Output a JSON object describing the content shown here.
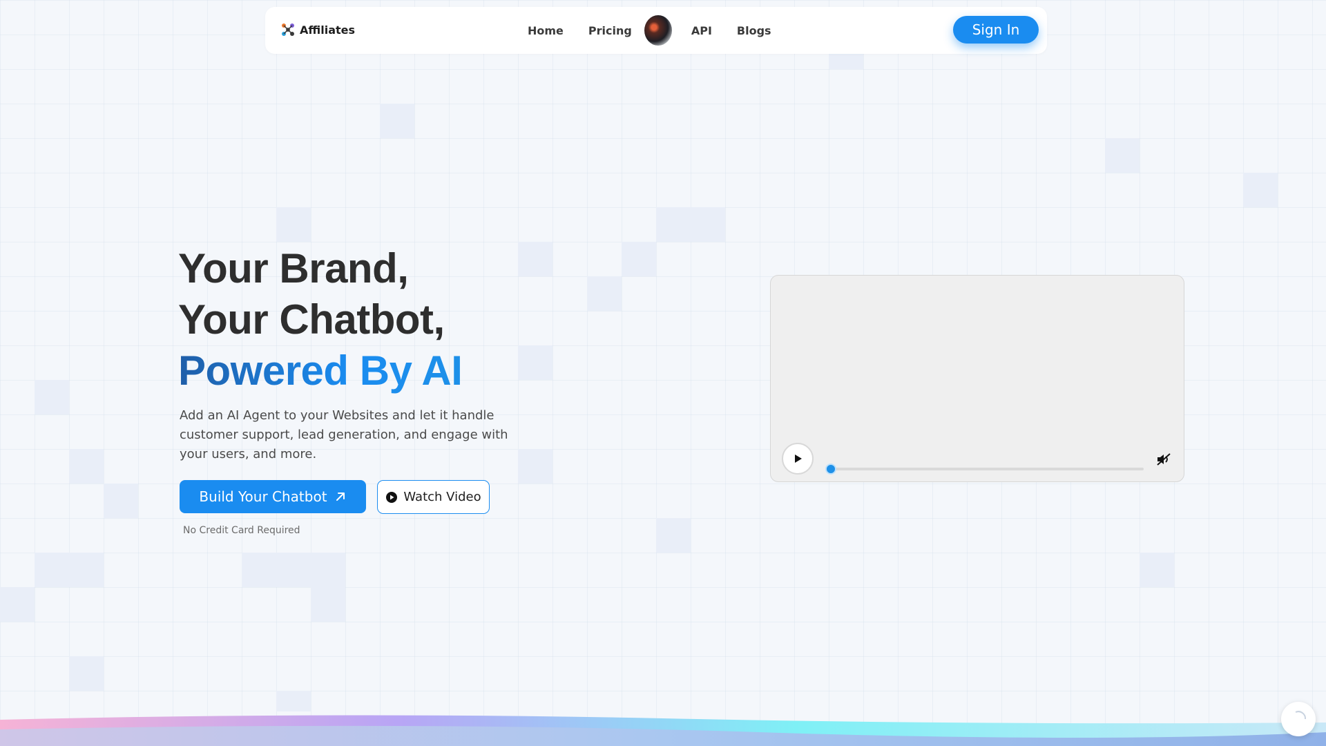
{
  "nav": {
    "brand": "Affiliates",
    "links": [
      "Home",
      "Pricing",
      "API",
      "Blogs"
    ],
    "signin_label": "Sign In"
  },
  "hero": {
    "title_line1": "Your Brand,",
    "title_line2": "Your Chatbot,",
    "title_line3": "Powered By AI",
    "description": "Add an AI Agent to your Websites and let it handle customer support, lead generation, and engage with your users, and more.",
    "primary_cta": "Build Your Chatbot",
    "secondary_cta": "Watch Video",
    "note": "No Credit Card Required"
  },
  "video": {
    "progress": 0
  },
  "colors": {
    "accent": "#1a8cf0",
    "title": "#2e2e2e",
    "background": "#f4f7fb"
  },
  "icons": [
    "brand-logo-icon",
    "avatar-icon",
    "arrow-up-right-icon",
    "play-circle-icon",
    "play-icon",
    "mute-icon",
    "chat-widget-icon"
  ]
}
